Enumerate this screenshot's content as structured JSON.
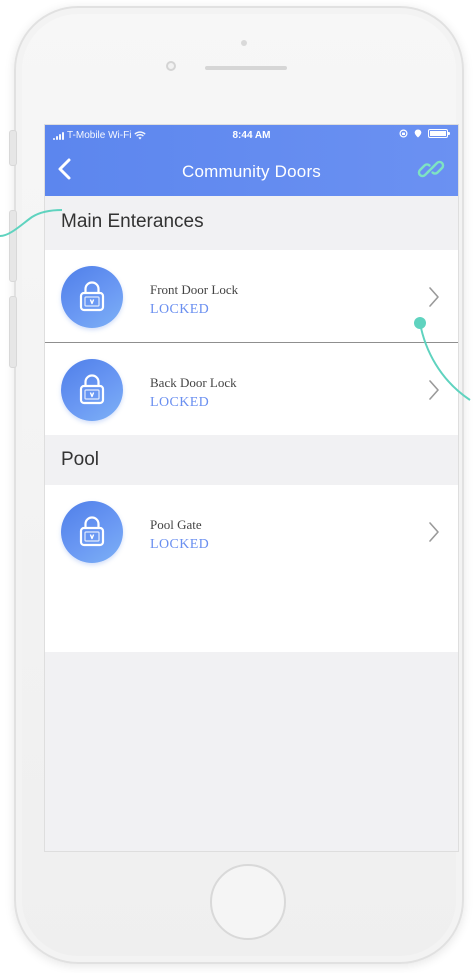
{
  "status_bar": {
    "carrier": "T-Mobile Wi-Fi",
    "time": "8:44 AM"
  },
  "header": {
    "title": "Community Doors"
  },
  "sections": [
    {
      "title": "Main Enterances",
      "items": [
        {
          "name": "Front Door Lock",
          "status": "LOCKED"
        },
        {
          "name": "Back Door Lock",
          "status": "LOCKED"
        }
      ]
    },
    {
      "title": "Pool",
      "items": [
        {
          "name": "Pool Gate",
          "status": "LOCKED"
        }
      ]
    }
  ],
  "colors": {
    "header": "#5c86ee",
    "accent": "#6a8ff0",
    "annotation_line": "#5fd3bf"
  },
  "icons": {
    "back": "chevron-left-icon",
    "link": "chain-link-icon",
    "lock": "padlock-icon",
    "disclosure": "chevron-right-icon"
  }
}
